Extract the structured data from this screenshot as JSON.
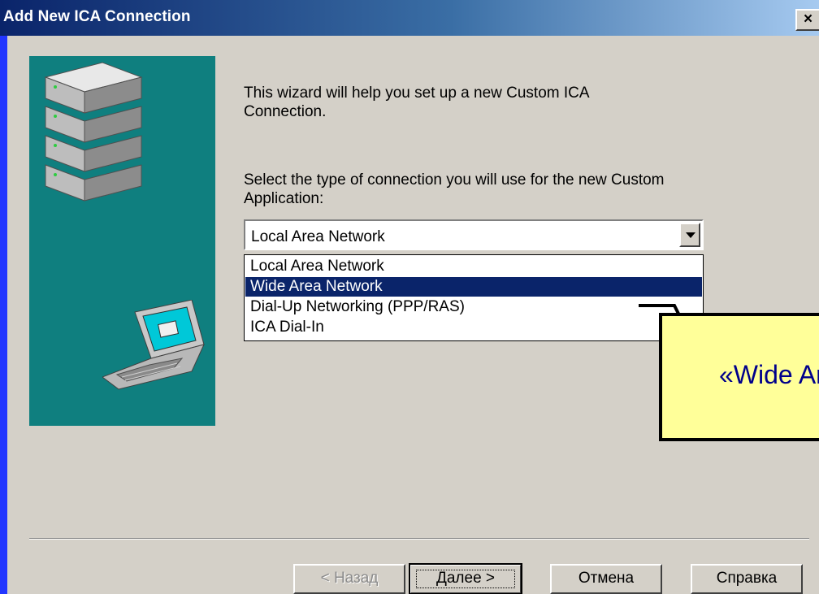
{
  "window": {
    "title": "Add New ICA Connection",
    "close_label": "×"
  },
  "wizard": {
    "intro_text": "This wizard will help you set up a new Custom ICA Connection.",
    "prompt_text": "Select the type of connection you will use for the new Custom Application:"
  },
  "connection_type": {
    "selected": "Local Area Network",
    "options": [
      "Local Area Network",
      "Wide Area Network",
      "Dial-Up Networking (PPP/RAS)",
      "ICA Dial-In"
    ],
    "highlighted_option": "Wide Area Network"
  },
  "buttons": {
    "back": "< Назад",
    "next": "Далее >",
    "cancel": "Отмена",
    "help": "Справка"
  },
  "callout": {
    "text": "«Wide Area Network»"
  },
  "icons": [
    "server-stack-icon",
    "laptop-icon",
    "dropdown-arrow-icon",
    "close-icon"
  ],
  "colors": {
    "title_bar": "#0a246a",
    "side_panel": "#0f7f7f",
    "dialog_bg": "#d4d0c8",
    "selection": "#0a246a",
    "callout_bg": "#ffff99",
    "callout_text": "#00008b",
    "frame": "#2236ff"
  }
}
